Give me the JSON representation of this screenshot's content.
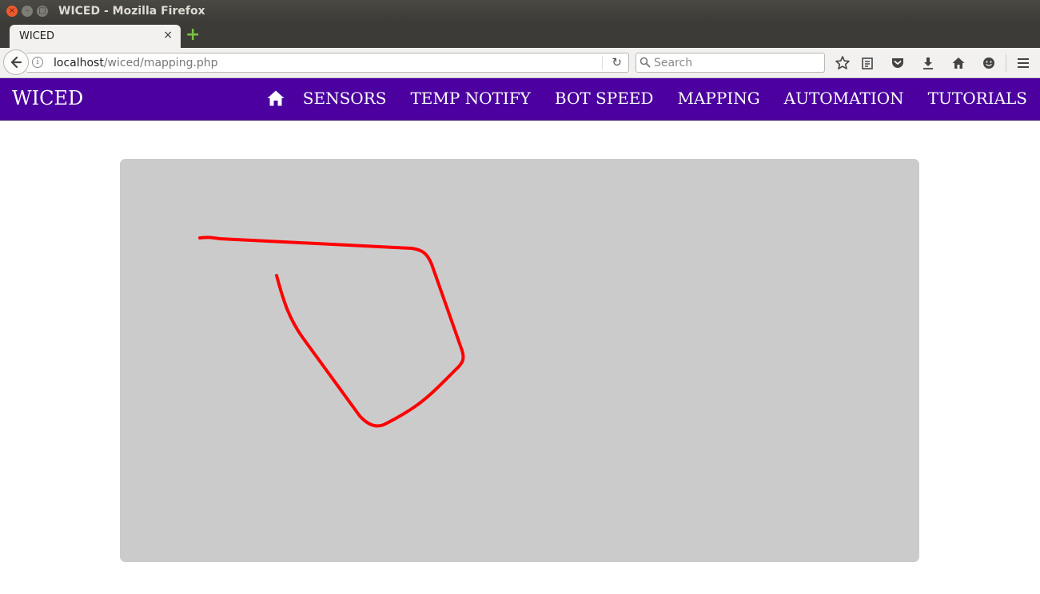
{
  "window": {
    "title": "WICED - Mozilla Firefox",
    "controls": {
      "close_glyph": "×",
      "minimize_glyph": "–",
      "maximize_glyph": "□"
    }
  },
  "browser": {
    "tab": {
      "title": "WICED",
      "close_glyph": "×"
    },
    "new_tab_glyph": "+",
    "url": {
      "host": "localhost",
      "path": "/wiced/mapping.php"
    },
    "search": {
      "placeholder": "Search"
    },
    "toolbar_icons": [
      "star-icon",
      "reading-list-icon",
      "pocket-icon",
      "download-icon",
      "home-icon",
      "smiley-icon",
      "menu-icon"
    ]
  },
  "site": {
    "brand": "WICED",
    "nav": [
      "SENSORS",
      "TEMP NOTIFY",
      "BOT SPEED",
      "MAPPING",
      "AUTOMATION",
      "TUTORIALS"
    ],
    "nav_background": "#4b009f"
  },
  "map": {
    "background": "#cbcbcb",
    "path_color": "#ff0000"
  }
}
